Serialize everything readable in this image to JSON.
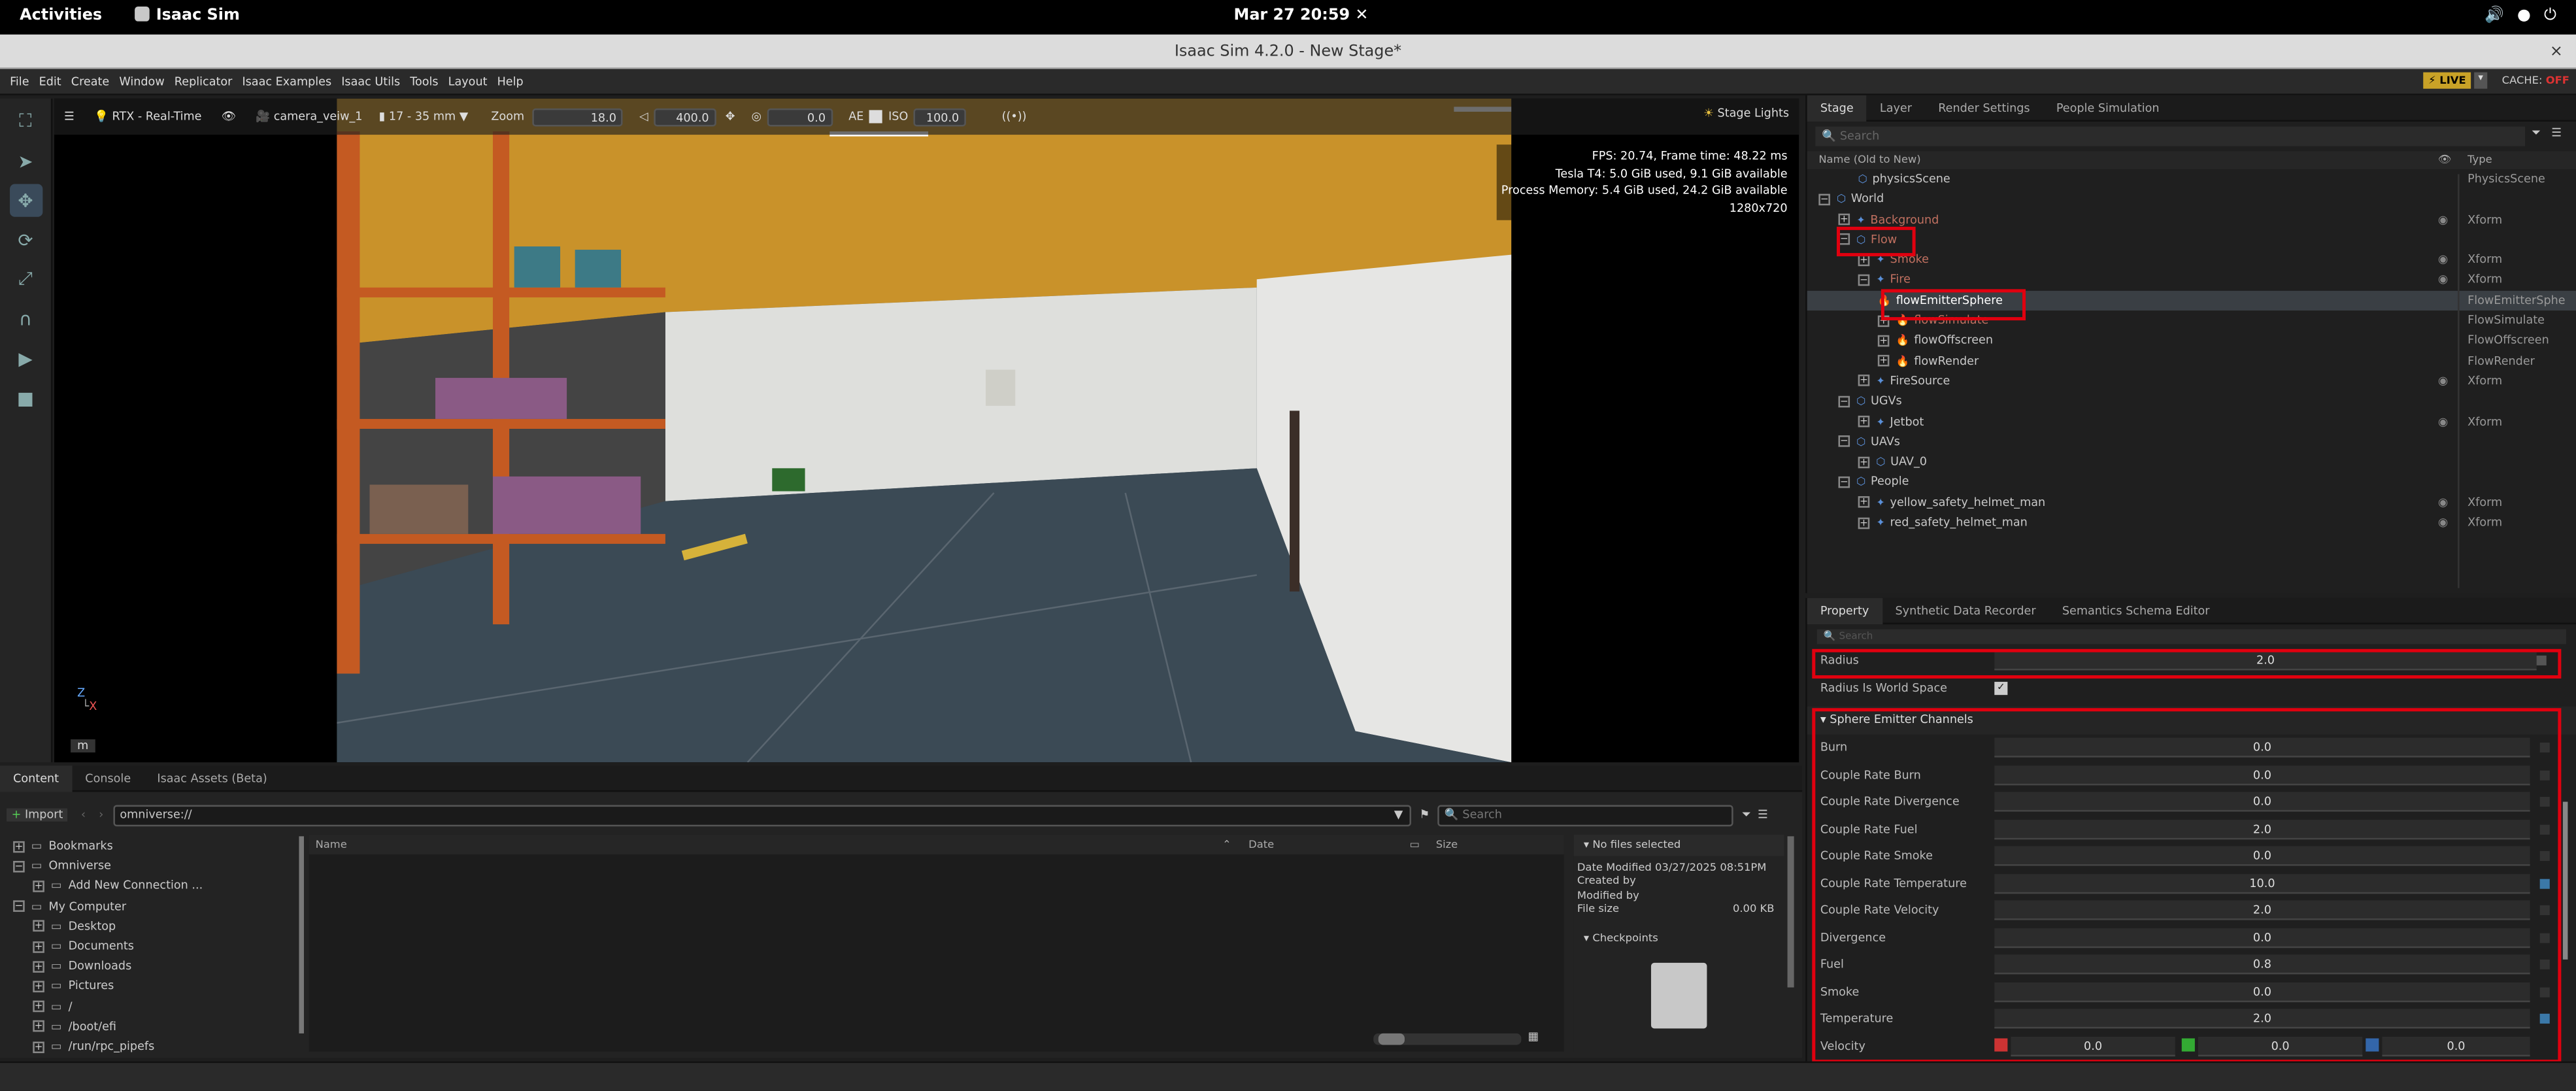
{
  "gnome": {
    "activities": "Activities",
    "app": "Isaac Sim",
    "clock": "Mar 27  20:59"
  },
  "window": {
    "title": "Isaac Sim 4.2.0 - New Stage*",
    "close": "×"
  },
  "menu": [
    "File",
    "Edit",
    "Create",
    "Window",
    "Replicator",
    "Isaac Examples",
    "Isaac Utils",
    "Tools",
    "Layout",
    "Help"
  ],
  "menu_right": {
    "live": "LIVE",
    "cache_label": "CACHE:",
    "cache_value": "OFF"
  },
  "viewport": {
    "renderer": "RTX - Real-Time",
    "camera": "camera_veiw_1",
    "lens": "17 - 35 mm",
    "zoom_label": "Zoom",
    "zoom_value": "18.0",
    "fstop_value": "400.0",
    "exposure_value": "0.0",
    "ae_label": "AE",
    "iso_label": "ISO",
    "iso_value": "100.0",
    "stage_lights": "Stage Lights",
    "hud": [
      "FPS: 20.74, Frame time: 48.22 ms",
      "Tesla T4: 5.0 GiB used, 9.1 GiB available",
      "Process Memory: 5.4 GiB used, 24.2 GiB available",
      "1280x720"
    ],
    "axis_z": "Z",
    "axis_x": "X",
    "unit": "m"
  },
  "content": {
    "tabs": [
      "Content",
      "Console",
      "Isaac Assets (Beta)"
    ],
    "import": "Import",
    "path": "omniverse://",
    "search_placeholder": "Search",
    "tree": [
      {
        "label": "Bookmarks",
        "exp": "+",
        "indent": 0
      },
      {
        "label": "Omniverse",
        "exp": "−",
        "indent": 0
      },
      {
        "label": "Add New Connection ...",
        "exp": "+",
        "indent": 1
      },
      {
        "label": "My Computer",
        "exp": "−",
        "indent": 0
      },
      {
        "label": "Desktop",
        "exp": "+",
        "indent": 1
      },
      {
        "label": "Documents",
        "exp": "+",
        "indent": 1
      },
      {
        "label": "Downloads",
        "exp": "+",
        "indent": 1
      },
      {
        "label": "Pictures",
        "exp": "+",
        "indent": 1
      },
      {
        "label": "/",
        "exp": "+",
        "indent": 1
      },
      {
        "label": "/boot/efi",
        "exp": "+",
        "indent": 1
      },
      {
        "label": "/run/rpc_pipefs",
        "exp": "+",
        "indent": 1
      }
    ],
    "columns": {
      "name": "Name",
      "date": "Date",
      "size": "Size"
    },
    "info": {
      "heading": "No files selected",
      "modified": "Date Modified 03/27/2025 08:51PM",
      "created": "Created by",
      "modified_by": "Modified by",
      "file_size_label": "File size",
      "file_size": "0.00 KB",
      "checkpoints": "Checkpoints"
    }
  },
  "stage": {
    "tabs": [
      "Stage",
      "Layer",
      "Render Settings",
      "People Simulation"
    ],
    "search_placeholder": "Search",
    "col_name": "Name (Old to New)",
    "col_type": "Type",
    "rows": [
      {
        "name": "physicsScene",
        "type": "PhysicsScene",
        "indent": 2,
        "exp": "",
        "eye": ""
      },
      {
        "name": "World",
        "type": "",
        "indent": 0,
        "exp": "−",
        "eye": ""
      },
      {
        "name": "Background",
        "type": "Xform",
        "indent": 1,
        "exp": "+",
        "eye": "◉"
      },
      {
        "name": "Flow",
        "type": "",
        "indent": 1,
        "exp": "−",
        "eye": ""
      },
      {
        "name": "Smoke",
        "type": "Xform",
        "indent": 2,
        "exp": "+",
        "eye": "◉"
      },
      {
        "name": "Fire",
        "type": "Xform",
        "indent": 2,
        "exp": "−",
        "eye": "◉"
      },
      {
        "name": "flowEmitterSphere",
        "type": "FlowEmitterSphe",
        "indent": 3,
        "exp": "",
        "eye": ""
      },
      {
        "name": "flowSimulate",
        "type": "FlowSimulate",
        "indent": 3,
        "exp": "+",
        "eye": ""
      },
      {
        "name": "flowOffscreen",
        "type": "FlowOffscreen",
        "indent": 3,
        "exp": "+",
        "eye": ""
      },
      {
        "name": "flowRender",
        "type": "FlowRender",
        "indent": 3,
        "exp": "+",
        "eye": ""
      },
      {
        "name": "FireSource",
        "type": "Xform",
        "indent": 2,
        "exp": "+",
        "eye": "◉"
      },
      {
        "name": "UGVs",
        "type": "",
        "indent": 1,
        "exp": "−",
        "eye": ""
      },
      {
        "name": "Jetbot",
        "type": "Xform",
        "indent": 2,
        "exp": "+",
        "eye": "◉"
      },
      {
        "name": "UAVs",
        "type": "",
        "indent": 1,
        "exp": "−",
        "eye": ""
      },
      {
        "name": "UAV_0",
        "type": "",
        "indent": 2,
        "exp": "+",
        "eye": ""
      },
      {
        "name": "People",
        "type": "",
        "indent": 1,
        "exp": "−",
        "eye": ""
      },
      {
        "name": "yellow_safety_helmet_man",
        "type": "Xform",
        "indent": 2,
        "exp": "+",
        "eye": "◉"
      },
      {
        "name": "red_safety_helmet_man",
        "type": "Xform",
        "indent": 2,
        "exp": "+",
        "eye": "◉"
      }
    ]
  },
  "property": {
    "tabs": [
      "Property",
      "Synthetic Data Recorder",
      "Semantics Schema Editor"
    ],
    "search_placeholder": "Search",
    "radius_label": "Radius",
    "radius_value": "2.0",
    "radius_ws_label": "Radius Is World Space",
    "section": "Sphere Emitter Channels",
    "fields": [
      {
        "label": "Burn",
        "value": "0.0",
        "blue": false
      },
      {
        "label": "Couple Rate Burn",
        "value": "0.0",
        "blue": false
      },
      {
        "label": "Couple Rate Divergence",
        "value": "0.0",
        "blue": false
      },
      {
        "label": "Couple Rate Fuel",
        "value": "2.0",
        "blue": false
      },
      {
        "label": "Couple Rate Smoke",
        "value": "0.0",
        "blue": false
      },
      {
        "label": "Couple Rate Temperature",
        "value": "10.0",
        "blue": true
      },
      {
        "label": "Couple Rate Velocity",
        "value": "2.0",
        "blue": false
      },
      {
        "label": "Divergence",
        "value": "0.0",
        "blue": false
      },
      {
        "label": "Fuel",
        "value": "0.8",
        "blue": false
      },
      {
        "label": "Smoke",
        "value": "0.0",
        "blue": false
      },
      {
        "label": "Temperature",
        "value": "2.0",
        "blue": true
      }
    ],
    "velocity_label": "Velocity",
    "velocity": [
      "0.0",
      "0.0",
      "0.0"
    ]
  }
}
